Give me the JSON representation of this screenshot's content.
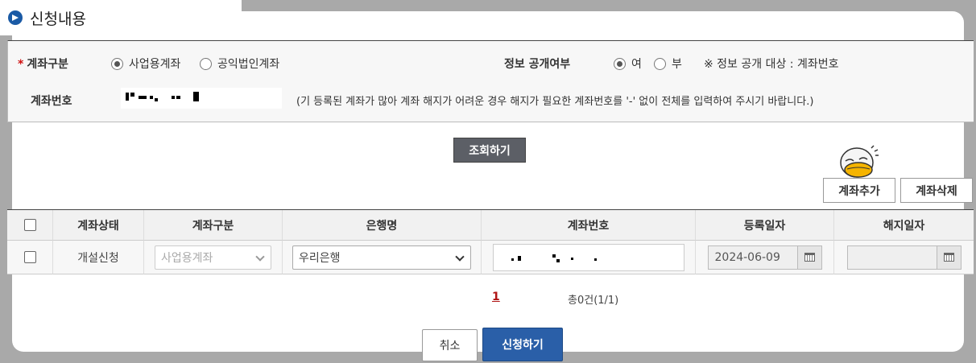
{
  "section": {
    "title": "신청내용"
  },
  "form": {
    "account_type_label": "계좌구분",
    "account_type_options": [
      "사업용계좌",
      "공익법인계좌"
    ],
    "disclosure_label": "정보 공개여부",
    "disclosure_options": [
      "여",
      "부"
    ],
    "disclosure_note": "※ 정보 공개 대상 : 계좌번호",
    "account_no_label": "계좌번호",
    "account_no_hint": "(기 등록된 계좌가 많아 계좌 해지가 어려운 경우 해지가 필요한 계좌번호를 '-' 없이 전체를 입력하여 주시기 바랍니다.)"
  },
  "buttons": {
    "search": "조회하기",
    "add_account": "계좌추가",
    "delete_account": "계좌삭제",
    "cancel": "취소",
    "apply": "신청하기"
  },
  "table": {
    "headers": [
      "계좌상태",
      "계좌구분",
      "은행명",
      "계좌번호",
      "등록일자",
      "해지일자"
    ],
    "rows": [
      {
        "status": "개설신청",
        "type": "사업용계좌",
        "bank": "우리은행",
        "reg_date": "2024-06-09",
        "end_date": ""
      }
    ]
  },
  "pagination": {
    "current": "1",
    "total": "총0건(1/1)"
  },
  "colors": {
    "primary": "#2a5fa8",
    "dark_button": "#5c5f66",
    "required": "#d01010"
  }
}
